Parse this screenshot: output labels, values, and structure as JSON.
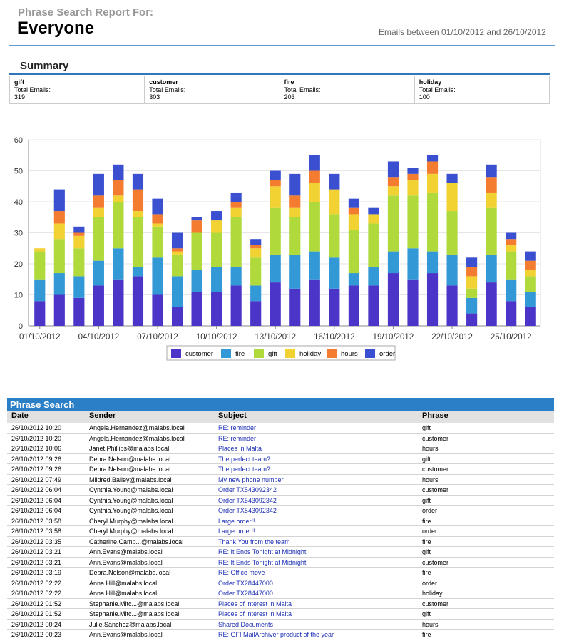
{
  "report": {
    "heading": "Phrase Search Report For:",
    "name": "Everyone",
    "date_range": "Emails between 01/10/2012 and 26/10/2012"
  },
  "summary": {
    "title": "Summary",
    "cards": [
      {
        "term": "gift",
        "label": "Total Emails:",
        "value": "319"
      },
      {
        "term": "customer",
        "label": "Total Emails:",
        "value": "303"
      },
      {
        "term": "fire",
        "label": "Total Emails:",
        "value": "203"
      },
      {
        "term": "holiday",
        "label": "Total Emails:",
        "value": "100"
      }
    ]
  },
  "chart_data": {
    "type": "bar",
    "stacked": true,
    "ylim": [
      0,
      60
    ],
    "yticks": [
      0,
      10,
      20,
      30,
      40,
      50,
      60
    ],
    "grid": true,
    "legend_position": "bottom",
    "categories": [
      "01/10/2012",
      "02/10/2012",
      "03/10/2012",
      "04/10/2012",
      "05/10/2012",
      "06/10/2012",
      "07/10/2012",
      "08/10/2012",
      "09/10/2012",
      "10/10/2012",
      "11/10/2012",
      "12/10/2012",
      "13/10/2012",
      "14/10/2012",
      "15/10/2012",
      "16/10/2012",
      "17/10/2012",
      "18/10/2012",
      "19/10/2012",
      "20/10/2012",
      "21/10/2012",
      "22/10/2012",
      "23/10/2012",
      "24/10/2012",
      "25/10/2012",
      "26/10/2012"
    ],
    "x_tick_labels": [
      "01/10/2012",
      "04/10/2012",
      "07/10/2012",
      "10/10/2012",
      "13/10/2012",
      "16/10/2012",
      "19/10/2012",
      "22/10/2012",
      "25/10/2012"
    ],
    "series": [
      {
        "name": "customer",
        "color": "#4b35c8",
        "values": [
          8,
          10,
          9,
          13,
          15,
          16,
          10,
          6,
          11,
          11,
          13,
          8,
          14,
          12,
          15,
          12,
          13,
          13,
          17,
          15,
          17,
          13,
          4,
          14,
          8,
          6
        ]
      },
      {
        "name": "fire",
        "color": "#3399d6",
        "values": [
          7,
          7,
          7,
          8,
          10,
          3,
          12,
          10,
          7,
          8,
          6,
          5,
          9,
          11,
          9,
          10,
          4,
          6,
          7,
          10,
          7,
          10,
          5,
          9,
          7,
          5
        ]
      },
      {
        "name": "gift",
        "color": "#b0d93b",
        "values": [
          9,
          11,
          9,
          14,
          15,
          16,
          10,
          7,
          12,
          11,
          16,
          9,
          15,
          12,
          16,
          14,
          14,
          14,
          18,
          17,
          19,
          14,
          3,
          15,
          9,
          5
        ]
      },
      {
        "name": "holiday",
        "color": "#f2d232",
        "values": [
          1,
          5,
          4,
          3,
          2,
          2,
          1,
          1,
          0,
          4,
          3,
          3,
          7,
          3,
          6,
          8,
          5,
          3,
          3,
          5,
          6,
          9,
          4,
          5,
          2,
          2
        ]
      },
      {
        "name": "hours",
        "color": "#f47c30",
        "values": [
          0,
          4,
          1,
          4,
          5,
          7,
          3,
          1,
          4,
          0,
          2,
          1,
          2,
          4,
          4,
          0,
          2,
          0,
          3,
          2,
          4,
          0,
          3,
          5,
          2,
          3
        ]
      },
      {
        "name": "order",
        "color": "#3a50d0",
        "values": [
          0,
          7,
          2,
          7,
          5,
          5,
          5,
          5,
          1,
          3,
          3,
          2,
          3,
          7,
          5,
          5,
          3,
          2,
          5,
          2,
          2,
          3,
          3,
          4,
          2,
          3
        ]
      }
    ]
  },
  "table": {
    "title": "Phrase Search",
    "headers": {
      "date": "Date",
      "sender": "Sender",
      "subject": "Subject",
      "phrase": "Phrase"
    },
    "rows": [
      {
        "date": "26/10/2012 10:20",
        "sender": "Angela.Hernandez@malabs.local",
        "subject": "RE: reminder",
        "phrase": "gift"
      },
      {
        "date": "26/10/2012 10:20",
        "sender": "Angela.Hernandez@malabs.local",
        "subject": "RE: reminder",
        "phrase": "customer"
      },
      {
        "date": "26/10/2012 10:06",
        "sender": "Janet.Phillips@malabs.local",
        "subject": "Places in Malta",
        "phrase": "hours"
      },
      {
        "date": "26/10/2012 09:26",
        "sender": "Debra.Nelson@malabs.local",
        "subject": "The perfect team?",
        "phrase": "gift"
      },
      {
        "date": "26/10/2012 09:26",
        "sender": "Debra.Nelson@malabs.local",
        "subject": "The perfect team?",
        "phrase": "customer"
      },
      {
        "date": "26/10/2012 07:49",
        "sender": "Mildred.Bailey@malabs.local",
        "subject": "My new phone number",
        "phrase": "hours"
      },
      {
        "date": "26/10/2012 06:04",
        "sender": "Cynthia.Young@malabs.local",
        "subject": "Order TX543092342",
        "phrase": "customer"
      },
      {
        "date": "26/10/2012 06:04",
        "sender": "Cynthia.Young@malabs.local",
        "subject": "Order TX543092342",
        "phrase": "gift"
      },
      {
        "date": "26/10/2012 06:04",
        "sender": "Cynthia.Young@malabs.local",
        "subject": "Order TX543092342",
        "phrase": "order"
      },
      {
        "date": "26/10/2012 03:58",
        "sender": "Cheryl.Murphy@malabs.local",
        "subject": "Large order!!",
        "phrase": "fire"
      },
      {
        "date": "26/10/2012 03:58",
        "sender": "Cheryl.Murphy@malabs.local",
        "subject": "Large order!!",
        "phrase": "order"
      },
      {
        "date": "26/10/2012 03:35",
        "sender": "Catherine.Camp...@malabs.local",
        "subject": "Thank You from the team",
        "phrase": "fire"
      },
      {
        "date": "26/10/2012 03:21",
        "sender": "Ann.Evans@malabs.local",
        "subject": "RE: It Ends Tonight at Midnight",
        "phrase": "gift"
      },
      {
        "date": "26/10/2012 03:21",
        "sender": "Ann.Evans@malabs.local",
        "subject": "RE: It Ends Tonight at Midnight",
        "phrase": "customer"
      },
      {
        "date": "26/10/2012 03:19",
        "sender": "Debra.Nelson@malabs.local",
        "subject": "RE: Office move",
        "phrase": "fire"
      },
      {
        "date": "26/10/2012 02:22",
        "sender": "Anna.Hill@malabs.local",
        "subject": "Order TX28447000",
        "phrase": "order"
      },
      {
        "date": "26/10/2012 02:22",
        "sender": "Anna.Hill@malabs.local",
        "subject": "Order TX28447000",
        "phrase": "holiday"
      },
      {
        "date": "26/10/2012 01:52",
        "sender": "Stephanie.Mitc...@malabs.local",
        "subject": "Places of interest in Malta",
        "phrase": "customer"
      },
      {
        "date": "26/10/2012 01:52",
        "sender": "Stephanie.Mitc...@malabs.local",
        "subject": "Places of interest in Malta",
        "phrase": "gift"
      },
      {
        "date": "26/10/2012 00:24",
        "sender": "Julie.Sanchez@malabs.local",
        "subject": "Shared Documents",
        "phrase": "hours"
      },
      {
        "date": "26/10/2012 00:23",
        "sender": "Ann.Evans@malabs.local",
        "subject": "RE: GFI MailArchiver product of the year",
        "phrase": "fire"
      }
    ]
  }
}
